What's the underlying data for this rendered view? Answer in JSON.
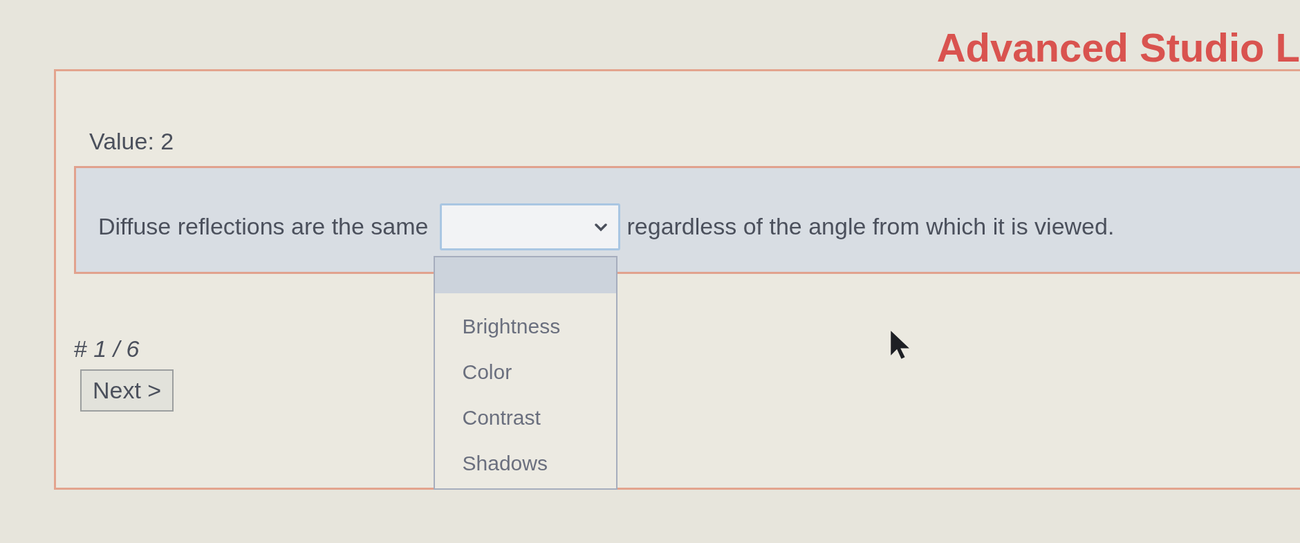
{
  "header": {
    "title": "Advanced Studio L"
  },
  "value_label": "Value: 2",
  "question": {
    "text_before": "Diffuse reflections are the same",
    "text_after": "regardless of the angle from which it is viewed.",
    "select": {
      "expanded": true,
      "options": [
        {
          "label": "Brightness",
          "selected": false
        },
        {
          "label": "Color",
          "selected": false
        },
        {
          "label": "Contrast",
          "selected": false
        },
        {
          "label": "Shadows",
          "selected": false
        }
      ]
    }
  },
  "counter": "# *1 / 6*",
  "next_button": {
    "label": "Next >"
  }
}
